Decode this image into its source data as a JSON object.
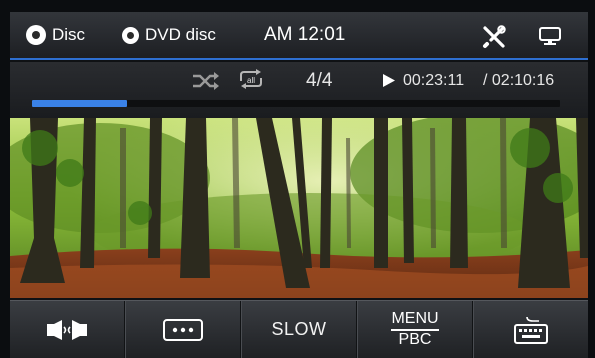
{
  "status_bar": {
    "source_label": "Disc",
    "media_label": "DVD disc",
    "clock": "AM 12:01"
  },
  "playback": {
    "track": "4/4",
    "elapsed": "00:23:11",
    "total": "/ 02:10:16",
    "repeat_mode_label": "all",
    "progress_fraction": 0.18
  },
  "controls": {
    "slow_label": "SLOW",
    "menu_label": "MENU",
    "pbc_label": "PBC"
  },
  "colors": {
    "accent": "#3a82e8"
  },
  "icons": [
    "disc-icon",
    "tools-icon",
    "display-icon",
    "shuffle-icon",
    "repeat-all-icon",
    "play-icon",
    "audio-icon",
    "subtitle-icon",
    "keyboard-icon"
  ]
}
